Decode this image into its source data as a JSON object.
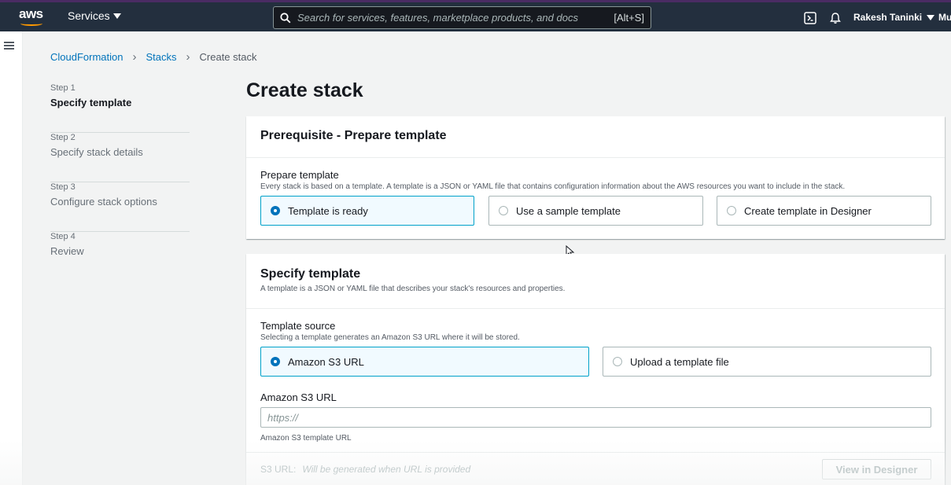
{
  "header": {
    "logo_text": "aws",
    "services_label": "Services",
    "search_placeholder": "Search for services, features, marketplace products, and docs",
    "search_shortcut": "[Alt+S]",
    "user_name": "Rakesh Taninki",
    "region_label": "Mu"
  },
  "breadcrumb": [
    "CloudFormation",
    "Stacks",
    "Create stack"
  ],
  "steps": [
    {
      "num": "Step 1",
      "name": "Specify template"
    },
    {
      "num": "Step 2",
      "name": "Specify stack details"
    },
    {
      "num": "Step 3",
      "name": "Configure stack options"
    },
    {
      "num": "Step 4",
      "name": "Review"
    }
  ],
  "page_title": "Create stack",
  "prerequisite": {
    "title": "Prerequisite - Prepare template",
    "field_label": "Prepare template",
    "field_desc": "Every stack is based on a template. A template is a JSON or YAML file that contains configuration information about the AWS resources you want to include in the stack.",
    "options": [
      "Template is ready",
      "Use a sample template",
      "Create template in Designer"
    ],
    "selected": "Template is ready"
  },
  "specify": {
    "title": "Specify template",
    "desc": "A template is a JSON or YAML file that describes your stack's resources and properties.",
    "source_label": "Template source",
    "source_desc": "Selecting a template generates an Amazon S3 URL where it will be stored.",
    "options": [
      "Amazon S3 URL",
      "Upload a template file"
    ],
    "selected": "Amazon S3 URL",
    "url_label": "Amazon S3 URL",
    "url_placeholder": "https://",
    "url_hint": "Amazon S3 template URL",
    "s3_url_label": "S3 URL:",
    "s3_url_value": "Will be generated when URL is provided",
    "designer_button": "View in Designer"
  },
  "colors": {
    "nav_bg": "#232f3e",
    "link": "#0073bb",
    "accent": "#ff9900",
    "selected_border": "#00a1c9"
  }
}
